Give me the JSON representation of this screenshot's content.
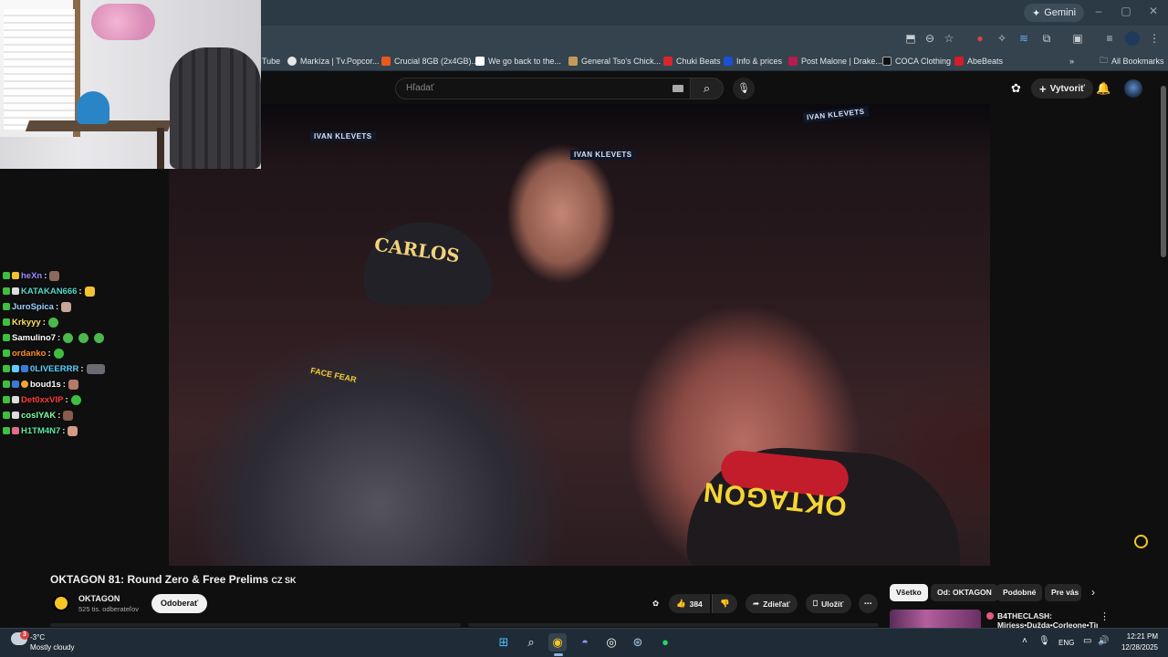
{
  "browser": {
    "gemini_label": "Gemini",
    "all_bookmarks": "All Bookmarks",
    "bookmarks": [
      {
        "label": "Tube",
        "color": "#ff0000"
      },
      {
        "label": "Markíza | Tv.Popcor...",
        "color": "#e8e8e8"
      },
      {
        "label": "Crucial 8GB (2x4GB)...",
        "color": "#e95a1c"
      },
      {
        "label": "We go back to the...",
        "color": "#ffffff"
      },
      {
        "label": "General Tso's Chick...",
        "color": "#c49a5a"
      },
      {
        "label": "Chuki Beats",
        "color": "#d7262d"
      },
      {
        "label": "Info & prices",
        "color": "#1a4fd6"
      },
      {
        "label": "Post Malone | Drake...",
        "color": "#b71c4d"
      },
      {
        "label": "COCA Clothing",
        "color": "#111111"
      },
      {
        "label": "AbeBeats",
        "color": "#d71b2b"
      }
    ]
  },
  "youtube": {
    "search_placeholder": "Hľadať",
    "create_label": "Vytvoriť",
    "video": {
      "title": "OKTAGON 81: Round Zero & Free Prelims",
      "title_tag": "CZ SK",
      "channel": "OKTAGON",
      "subscribers": "525 tis. odberateľov",
      "subscribe_label": "Odoberať",
      "likes": "384",
      "share_label": "Zdieľať",
      "save_label": "Uložiť",
      "banners": [
        "IVAN KLEVETS",
        "IVAN KLEVETS",
        "IVAN KLEVETS"
      ],
      "cap_text": "CARLOS",
      "glove_text": "OKTAGON",
      "shirt_text": "FACE FEAR"
    },
    "chips": [
      "Všetko",
      "Od: OKTAGON",
      "Podobné",
      "Pre vás"
    ],
    "recommendation": {
      "title": "B4THECLASH:",
      "subtitle": "Miriess•Dužda•Corleone•Tink"
    }
  },
  "chat": [
    {
      "user": "heXn",
      "color": "#9b8cff",
      "emotes": [
        "#8a6a5a"
      ]
    },
    {
      "user": "KATAKAN666",
      "color": "#58d6c9",
      "emotes": [
        "#f2c233"
      ]
    },
    {
      "user": "JuroSpica",
      "color": "#9bd1ff",
      "emotes": [
        "#c9a79a"
      ]
    },
    {
      "user": "Krkyyy",
      "color": "#ffe066",
      "emotes": [
        "#4bb84b"
      ]
    },
    {
      "user": "Samulino7",
      "color": "#ffffff",
      "emotes": [
        "#4bb84b",
        "#4bb84b",
        "#4bb84b"
      ]
    },
    {
      "user": "ordanko",
      "color": "#ff8c2e",
      "emotes": [
        "#3fbf3f"
      ]
    },
    {
      "user": "0LIVEERRR",
      "color": "#5ad1ff",
      "emotes": [
        "#6a6a70"
      ]
    },
    {
      "user": "boud1s",
      "color": "#ffffff",
      "emotes": [
        "#b57a6a"
      ]
    },
    {
      "user": "Det0xxVIP",
      "color": "#ff3b3b",
      "emotes": [
        "#3fbf3f"
      ]
    },
    {
      "user": "cosIYAK",
      "color": "#7fffa0",
      "emotes": [
        "#8a5a4a"
      ]
    },
    {
      "user": "H1TM4N7",
      "color": "#5ee6a0",
      "emotes": [
        "#d49b86"
      ]
    }
  ],
  "taskbar": {
    "temperature": "-3°C",
    "condition": "Mostly cloudy",
    "weather_badge": "3",
    "language": "ENG",
    "time": "12:21 PM",
    "date": "12/28/2025"
  }
}
